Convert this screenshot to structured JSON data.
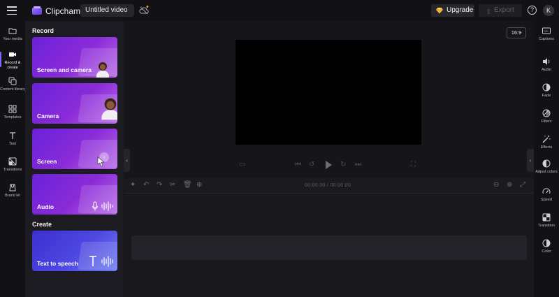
{
  "app": {
    "name": "Clipchamp",
    "project_title": "Untitled video"
  },
  "topbar": {
    "upgrade_label": "Upgrade",
    "export_label": "Export",
    "help_label": "?",
    "avatar_initial": "K"
  },
  "left_rail": {
    "items": [
      {
        "label": "Your media",
        "icon": "folder-icon"
      },
      {
        "label": "Record & create",
        "icon": "video-camera-icon",
        "active": true
      },
      {
        "label": "Content library",
        "icon": "library-icon"
      },
      {
        "label": "Templates",
        "icon": "templates-icon"
      },
      {
        "label": "Text",
        "icon": "text-icon"
      },
      {
        "label": "Transitions",
        "icon": "transitions-icon"
      },
      {
        "label": "Brand kit",
        "icon": "brand-kit-icon"
      }
    ]
  },
  "panel": {
    "record_heading": "Record",
    "create_heading": "Create",
    "cards": [
      {
        "label": "Screen and camera"
      },
      {
        "label": "Camera"
      },
      {
        "label": "Screen"
      },
      {
        "label": "Audio"
      },
      {
        "label": "Text to speech"
      }
    ]
  },
  "preview": {
    "aspect_ratio": "16:9"
  },
  "timeline": {
    "timecode": "00:00.00 / 00:00.00"
  },
  "right_rail": {
    "items": [
      {
        "label": "Captions",
        "icon": "captions-icon"
      },
      {
        "label": "Audio",
        "icon": "speaker-icon"
      },
      {
        "label": "Fade",
        "icon": "fade-icon"
      },
      {
        "label": "Filters",
        "icon": "filters-icon"
      },
      {
        "label": "Effects",
        "icon": "magic-wand-icon"
      },
      {
        "label": "Adjust colors",
        "icon": "adjust-colors-icon"
      },
      {
        "label": "Speed",
        "icon": "speedometer-icon"
      },
      {
        "label": "Transition",
        "icon": "transition-icon"
      },
      {
        "label": "Color",
        "icon": "color-icon"
      }
    ]
  },
  "colors": {
    "accent": "#7a6cff",
    "card_purple": "#8b2bd8",
    "card_blue": "#4f48e2",
    "background": "#16161a"
  }
}
